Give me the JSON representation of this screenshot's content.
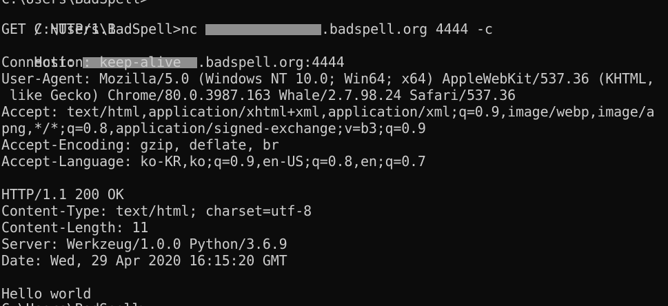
{
  "terminal": {
    "top_partial": "C:\\Users\\BadSpell>",
    "command": {
      "prompt": "C:\\Users\\BadSpell>nc ",
      "host_suffix": ".badspell.org 4444 -c"
    },
    "request": {
      "request_line": "GET / HTTP/1.1",
      "host_label": "Host: ",
      "host_suffix": ".badspell.org:4444",
      "connection": "Connection: keep-alive",
      "user_agent_1": "User-Agent: Mozilla/5.0 (Windows NT 10.0; Win64; x64) AppleWebKit/537.36 (KHTML,",
      "user_agent_2": " like Gecko) Chrome/80.0.3987.163 Whale/2.7.98.24 Safari/537.36",
      "accept_1": "Accept: text/html,application/xhtml+xml,application/xml;q=0.9,image/webp,image/a",
      "accept_2": "png,*/*;q=0.8,application/signed-exchange;v=b3;q=0.9",
      "accept_encoding": "Accept-Encoding: gzip, deflate, br",
      "accept_language": "Accept-Language: ko-KR,ko;q=0.9,en-US;q=0.8,en;q=0.7"
    },
    "response": {
      "status": "HTTP/1.1 200 OK",
      "content_type": "Content-Type: text/html; charset=utf-8",
      "content_length": "Content-Length: 11",
      "server": "Server: Werkzeug/1.0.0 Python/3.6.9",
      "date": "Date: Wed, 29 Apr 2020 16:15:20 GMT",
      "body": "Hello world"
    },
    "bottom_partial": "C:\\Users\\BadSpell>"
  },
  "colors": {
    "background": "#0c0c0c",
    "foreground": "#cccccc",
    "redaction": "#8e8e8e"
  }
}
